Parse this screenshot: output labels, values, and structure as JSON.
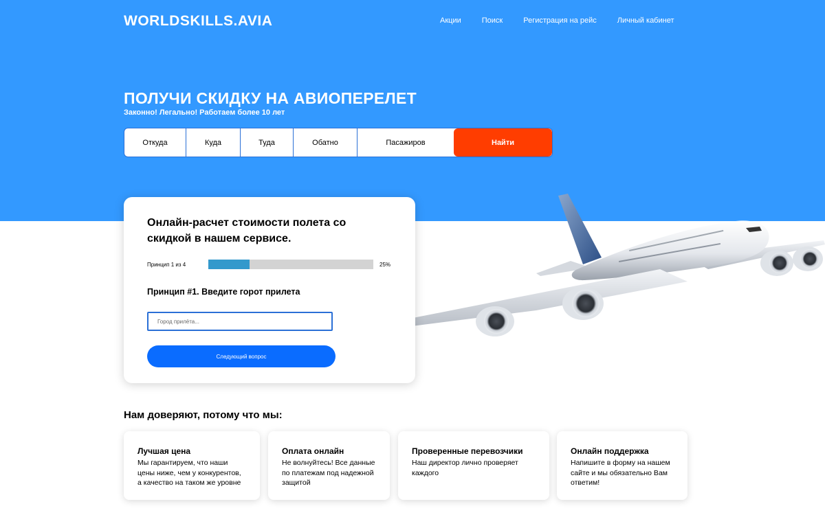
{
  "header": {
    "logo": "WORLDSKILLS.AVIA",
    "nav": [
      "Акции",
      "Поиск",
      "Регистрация на рейс",
      "Личный кабинет"
    ]
  },
  "hero": {
    "title": "ПОЛУЧИ СКИДКУ НА АВИОПЕРЕЛЕТ",
    "subtitle": "Законно! Легально! Работаем более 10 лет",
    "search": {
      "fields": [
        "Откуда",
        "Куда",
        "Туда",
        "Обатно",
        "Пасажиров"
      ],
      "button": "Найти"
    }
  },
  "calc_card": {
    "title": "Онлайн-расчет стоимости полета со скидкой в нашем сервисе.",
    "progress_label": "Принцип 1 из 4",
    "progress_value": 25,
    "progress_text": "25%",
    "question": "Принцип #1. Введите горот прилета",
    "input_placeholder": "Город прилёта...",
    "input_value": "",
    "next_button": "Следующий вопрос"
  },
  "trust": {
    "heading": "Нам доверяют, потому что мы:",
    "items": [
      {
        "title": "Лучшая цена",
        "text": "Мы гарантируем, что наши цены ниже, чем у конкурентов, а качество на таком же уровне"
      },
      {
        "title": "Оплата онлайн",
        "text": "Не волнуйтесь! Все данные по платежам под надежной защитой"
      },
      {
        "title": "Проверенные перевозчики",
        "text": "Наш директор лично проверяет каждого"
      },
      {
        "title": "Онлайн поддержка",
        "text": "Напишите в форму на нашем сайте и мы обязательно Вам ответим!"
      }
    ]
  },
  "colors": {
    "hero_blue": "#3399ff",
    "search_button": "#ff3d00",
    "next_button": "#0a6cff",
    "progress_fill": "#3399cc"
  }
}
